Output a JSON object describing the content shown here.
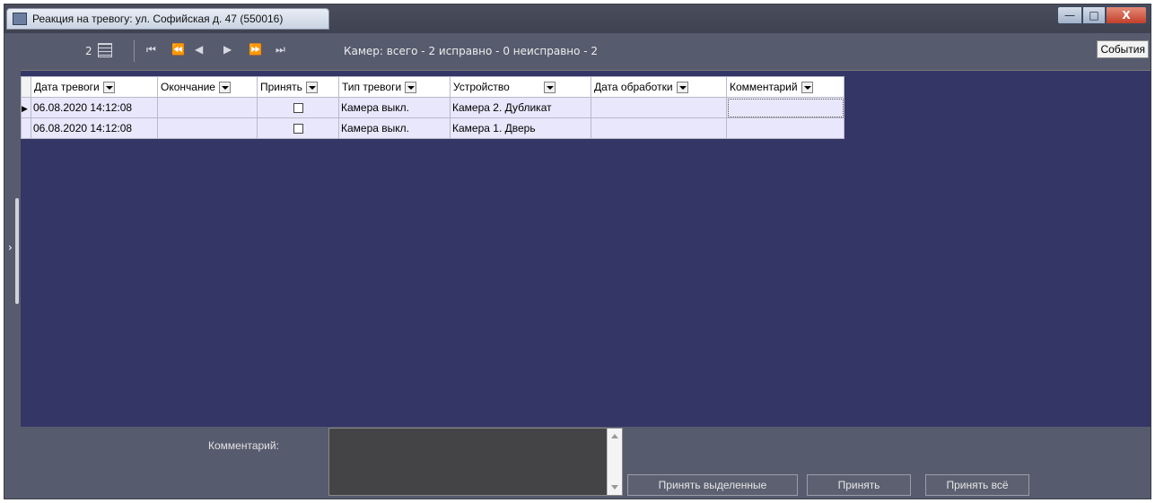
{
  "window": {
    "title": "Реакция на тревогу: ул. Софийская д. 47 (550016)",
    "events_button": "События"
  },
  "toolbar": {
    "count": "2",
    "camera_status": "Камер: всего - 2 исправно - 0  неисправно - 2"
  },
  "grid": {
    "columns": [
      "Дата тревоги",
      "Окончание",
      "Принять",
      "Тип тревоги",
      "Устройство",
      "Дата обработки",
      "Комментарий"
    ],
    "rows": [
      {
        "date": "06.08.2020 14:12:08",
        "end": "",
        "type": "Камера выкл.",
        "device": "Камера 2. Дубликат",
        "processed": "",
        "comment": "",
        "accepted": false,
        "selected": true
      },
      {
        "date": "06.08.2020 14:12:08",
        "end": "",
        "type": "Камера выкл.",
        "device": "Камера 1. Дверь",
        "processed": "",
        "comment": "",
        "accepted": false,
        "selected": false
      }
    ]
  },
  "bottom": {
    "comment_label": "Комментарий:",
    "comment_value": "",
    "btn_accept_selected": "Принять выделенные",
    "btn_accept": "Принять",
    "btn_accept_all": "Принять всё"
  },
  "colors": {
    "grid_background": "#343666",
    "panel": "#575b6e",
    "row": "#e9e7fb"
  }
}
